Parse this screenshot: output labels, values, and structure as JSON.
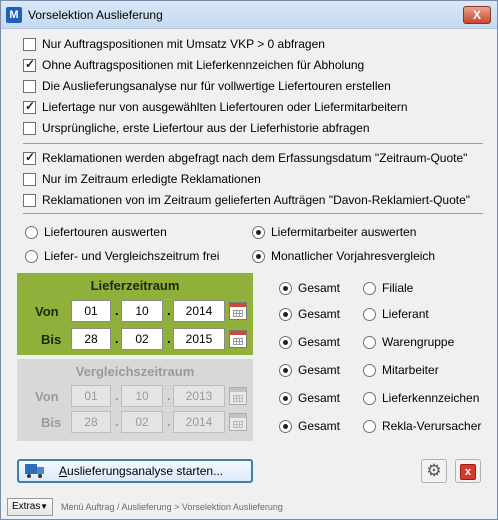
{
  "window": {
    "title": "Vorselektion Auslieferung",
    "app_icon_letter": "M",
    "close_label": "X"
  },
  "options_group1": [
    {
      "label": "Nur Auftragspositionen mit Umsatz VKP > 0 abfragen",
      "checked": false
    },
    {
      "label": "Ohne Auftragspositionen mit Lieferkennzeichen für Abholung",
      "checked": true
    },
    {
      "label": "Die Auslieferungsanalyse nur für vollwertige Liefertouren erstellen",
      "checked": false
    },
    {
      "label": "Liefertage nur von ausgewählten Liefertouren oder Liefermitarbeitern",
      "checked": true
    },
    {
      "label": "Ursprüngliche, erste Liefertour aus der Lieferhistorie abfragen",
      "checked": false
    }
  ],
  "options_group2": [
    {
      "label": "Reklamationen werden abgefragt nach dem Erfassungsdatum \"Zeitraum-Quote\"",
      "checked": true
    },
    {
      "label": "Nur im Zeitraum erledigte Reklamationen",
      "checked": false
    },
    {
      "label": "Reklamationen von im Zeitraum gelieferten Aufträgen  \"Davon-Reklamiert-Quote\"",
      "checked": false
    }
  ],
  "mode_radios": {
    "left": [
      {
        "label": "Liefertouren auswerten",
        "checked": false
      },
      {
        "label": "Liefer- und Vergleichszeitrum frei",
        "checked": false
      }
    ],
    "right": [
      {
        "label": "Liefermitarbeiter auswerten",
        "checked": true
      },
      {
        "label": "Monatlicher Vorjahresvergleich",
        "checked": true
      }
    ]
  },
  "lieferzeitraum": {
    "title": "Lieferzeitraum",
    "von": {
      "label": "Von",
      "day": "01",
      "month": "10",
      "year": "2014"
    },
    "bis": {
      "label": "Bis",
      "day": "28",
      "month": "02",
      "year": "2015"
    }
  },
  "vergleichszeitraum": {
    "title": "Vergleichszeitraum",
    "von": {
      "label": "Von",
      "day": "01",
      "month": "10",
      "year": "2013"
    },
    "bis": {
      "label": "Bis",
      "day": "28",
      "month": "02",
      "year": "2014"
    }
  },
  "date_separator": ".",
  "groupings": [
    {
      "gesamt": "Gesamt",
      "gesamt_checked": true,
      "option": "Filiale",
      "option_checked": false
    },
    {
      "gesamt": "Gesamt",
      "gesamt_checked": true,
      "option": "Lieferant",
      "option_checked": false
    },
    {
      "gesamt": "Gesamt",
      "gesamt_checked": true,
      "option": "Warengruppe",
      "option_checked": false
    },
    {
      "gesamt": "Gesamt",
      "gesamt_checked": true,
      "option": "Mitarbeiter",
      "option_checked": false
    },
    {
      "gesamt": "Gesamt",
      "gesamt_checked": true,
      "option": "Lieferkennzeichen",
      "option_checked": false
    },
    {
      "gesamt": "Gesamt",
      "gesamt_checked": true,
      "option": "Rekla-Verursacher",
      "option_checked": false
    }
  ],
  "actions": {
    "start_label": "Auslieferungsanalyse starten...",
    "cancel_label": "x"
  },
  "statusbar": {
    "extras_label": "Extras",
    "breadcrumb": "Menü Auftrag / Auslieferung > Vorselektion Auslieferung"
  }
}
